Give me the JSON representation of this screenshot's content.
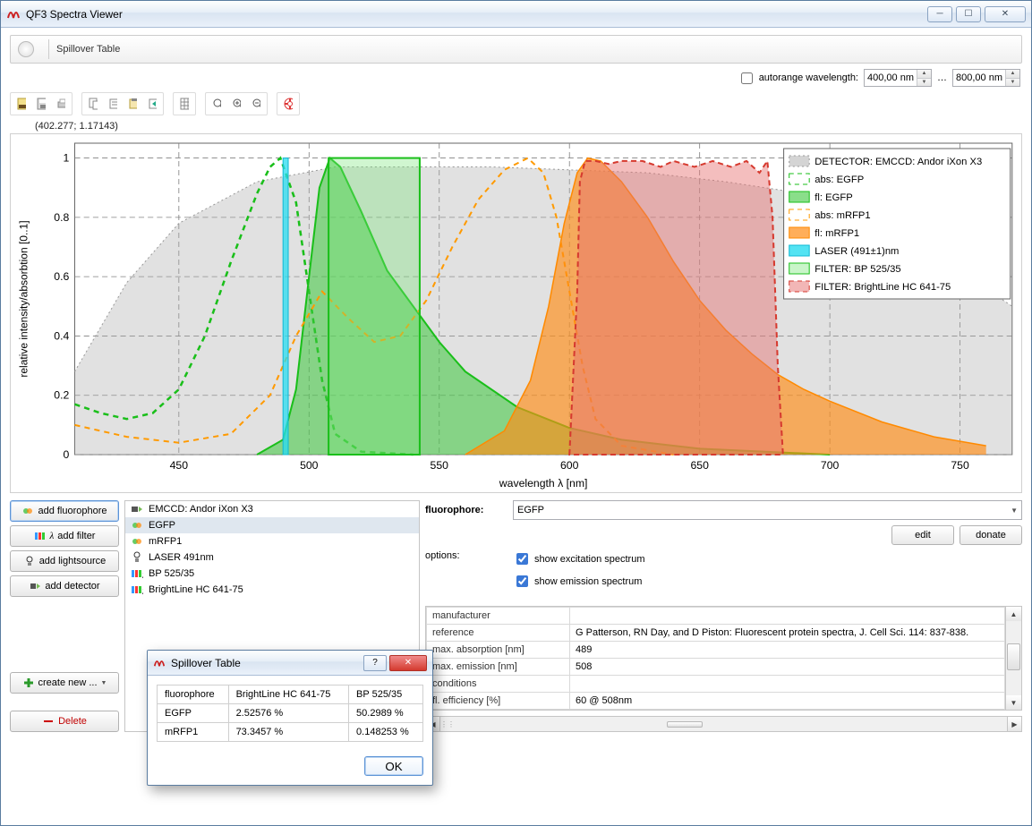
{
  "window": {
    "title": "QF3 Spectra Viewer"
  },
  "top_tab": {
    "label": "Spillover Table"
  },
  "autorange": {
    "checkbox_label": "autorange wavelength:",
    "checked": false,
    "from": "400,00 nm",
    "to": "800,00 nm",
    "ellipsis": "…"
  },
  "coord_readout": "(402.277; 1.17143)",
  "chart_data": {
    "type": "spectra",
    "xlabel": "wavelength λ [nm]",
    "ylabel": "relative intensity/absorbtion [0..1]",
    "xlim": [
      410,
      770
    ],
    "ylim": [
      0,
      1.05
    ],
    "xticks": [
      450,
      500,
      550,
      600,
      650,
      700,
      750
    ],
    "yticks": [
      0,
      0.2,
      0.4,
      0.6,
      0.8,
      1.0
    ],
    "series": [
      {
        "name": "DETECTOR: EMCCD: Andor iXon X3",
        "style": "area-grey",
        "points": [
          [
            410,
            0.28
          ],
          [
            430,
            0.58
          ],
          [
            450,
            0.78
          ],
          [
            480,
            0.92
          ],
          [
            510,
            0.97
          ],
          [
            540,
            0.97
          ],
          [
            570,
            0.97
          ],
          [
            600,
            0.96
          ],
          [
            630,
            0.95
          ],
          [
            660,
            0.92
          ],
          [
            690,
            0.88
          ],
          [
            720,
            0.78
          ],
          [
            750,
            0.62
          ],
          [
            770,
            0.5
          ]
        ]
      },
      {
        "name": "abs: EGFP",
        "style": "dash-green",
        "points": [
          [
            410,
            0.17
          ],
          [
            420,
            0.14
          ],
          [
            430,
            0.12
          ],
          [
            440,
            0.14
          ],
          [
            450,
            0.22
          ],
          [
            460,
            0.4
          ],
          [
            470,
            0.65
          ],
          [
            480,
            0.88
          ],
          [
            485,
            0.97
          ],
          [
            489,
            1.0
          ],
          [
            495,
            0.85
          ],
          [
            500,
            0.55
          ],
          [
            505,
            0.25
          ],
          [
            510,
            0.07
          ],
          [
            520,
            0.01
          ],
          [
            540,
            0.0
          ]
        ]
      },
      {
        "name": "fl: EGFP",
        "style": "fill-green",
        "points": [
          [
            480,
            0.0
          ],
          [
            490,
            0.05
          ],
          [
            495,
            0.22
          ],
          [
            500,
            0.6
          ],
          [
            504,
            0.9
          ],
          [
            508,
            1.0
          ],
          [
            512,
            0.97
          ],
          [
            520,
            0.82
          ],
          [
            530,
            0.62
          ],
          [
            540,
            0.5
          ],
          [
            550,
            0.38
          ],
          [
            560,
            0.28
          ],
          [
            580,
            0.16
          ],
          [
            600,
            0.09
          ],
          [
            620,
            0.05
          ],
          [
            650,
            0.02
          ],
          [
            700,
            0.0
          ]
        ]
      },
      {
        "name": "abs: mRFP1",
        "style": "dash-orange",
        "points": [
          [
            410,
            0.1
          ],
          [
            430,
            0.06
          ],
          [
            450,
            0.04
          ],
          [
            470,
            0.07
          ],
          [
            485,
            0.2
          ],
          [
            495,
            0.4
          ],
          [
            505,
            0.55
          ],
          [
            515,
            0.46
          ],
          [
            525,
            0.38
          ],
          [
            535,
            0.4
          ],
          [
            545,
            0.52
          ],
          [
            555,
            0.7
          ],
          [
            565,
            0.86
          ],
          [
            575,
            0.96
          ],
          [
            584,
            1.0
          ],
          [
            590,
            0.95
          ],
          [
            595,
            0.8
          ],
          [
            600,
            0.55
          ],
          [
            605,
            0.3
          ],
          [
            610,
            0.12
          ],
          [
            620,
            0.03
          ],
          [
            640,
            0.0
          ]
        ]
      },
      {
        "name": "fl: mRFP1",
        "style": "fill-orange",
        "points": [
          [
            560,
            0.0
          ],
          [
            575,
            0.08
          ],
          [
            585,
            0.25
          ],
          [
            592,
            0.5
          ],
          [
            598,
            0.78
          ],
          [
            603,
            0.95
          ],
          [
            607,
            1.0
          ],
          [
            612,
            0.99
          ],
          [
            620,
            0.92
          ],
          [
            630,
            0.8
          ],
          [
            640,
            0.65
          ],
          [
            650,
            0.52
          ],
          [
            660,
            0.42
          ],
          [
            670,
            0.34
          ],
          [
            680,
            0.27
          ],
          [
            690,
            0.22
          ],
          [
            700,
            0.18
          ],
          [
            720,
            0.11
          ],
          [
            740,
            0.06
          ],
          [
            760,
            0.03
          ]
        ]
      },
      {
        "name": "LASER (491±1)nm",
        "style": "laser-cyan",
        "center": 491,
        "halfwidth": 1
      },
      {
        "name": "FILTER: BP 525/35",
        "style": "filter-green",
        "low": 507.5,
        "high": 542.5
      },
      {
        "name": "FILTER: BrightLine HC 641-75",
        "style": "filter-red",
        "points": [
          [
            600,
            0.0
          ],
          [
            603,
            0.55
          ],
          [
            604,
            0.92
          ],
          [
            606,
            0.99
          ],
          [
            610,
            0.99
          ],
          [
            615,
            0.98
          ],
          [
            620,
            0.99
          ],
          [
            628,
            0.99
          ],
          [
            635,
            0.97
          ],
          [
            640,
            0.99
          ],
          [
            648,
            0.97
          ],
          [
            655,
            0.99
          ],
          [
            662,
            0.97
          ],
          [
            668,
            0.99
          ],
          [
            673,
            0.95
          ],
          [
            676,
            0.99
          ],
          [
            678,
            0.8
          ],
          [
            680,
            0.3
          ],
          [
            682,
            0.0
          ]
        ]
      }
    ],
    "legend": [
      "DETECTOR: EMCCD: Andor iXon X3",
      "abs: EGFP",
      "fl: EGFP",
      "abs: mRFP1",
      "fl: mRFP1",
      "LASER (491±1)nm",
      "FILTER: BP 525/35",
      "FILTER: BrightLine HC 641-75"
    ]
  },
  "left_buttons": {
    "add_fluorophore": "add fluorophore",
    "add_filter": "add filter",
    "add_lightsource": "add lightsource",
    "add_detector": "add detector",
    "create_new": "create new ...",
    "delete": "Delete"
  },
  "itemlist": [
    {
      "icon": "detector",
      "label": "EMCCD: Andor iXon X3"
    },
    {
      "icon": "fluoro",
      "label": "EGFP",
      "selected": true
    },
    {
      "icon": "fluoro",
      "label": "mRFP1"
    },
    {
      "icon": "laser",
      "label": "LASER 491nm"
    },
    {
      "icon": "filter",
      "label": "BP 525/35"
    },
    {
      "icon": "filter",
      "label": "BrightLine HC 641-75"
    }
  ],
  "fluorophore_form": {
    "label": "fluorophore:",
    "selected": "EGFP",
    "edit": "edit",
    "donate": "donate"
  },
  "options": {
    "label": "options:",
    "show_ex_label": "show excitation spectrum",
    "show_ex_checked": true,
    "show_em_label": "show emission spectrum",
    "show_em_checked": true
  },
  "properties": [
    {
      "key": "manufacturer",
      "val": ""
    },
    {
      "key": "reference",
      "val": "G Patterson, RN Day, and D Piston: Fluorescent protein spectra, J. Cell Sci. 114: 837-838."
    },
    {
      "key": "max. absorption [nm]",
      "val": "489"
    },
    {
      "key": "max. emission [nm]",
      "val": "508"
    },
    {
      "key": "conditions",
      "val": ""
    },
    {
      "key": "fl. efficiency [%]",
      "val": "60 @ 508nm"
    }
  ],
  "dialog": {
    "title": "Spillover Table",
    "headers": [
      "fluorophore",
      "BrightLine HC 641-75",
      "BP 525/35"
    ],
    "rows": [
      [
        "EGFP",
        "2.52576 %",
        "50.2989 %"
      ],
      [
        "mRFP1",
        "73.3457 %",
        "0.148253 %"
      ]
    ],
    "ok": "OK"
  }
}
